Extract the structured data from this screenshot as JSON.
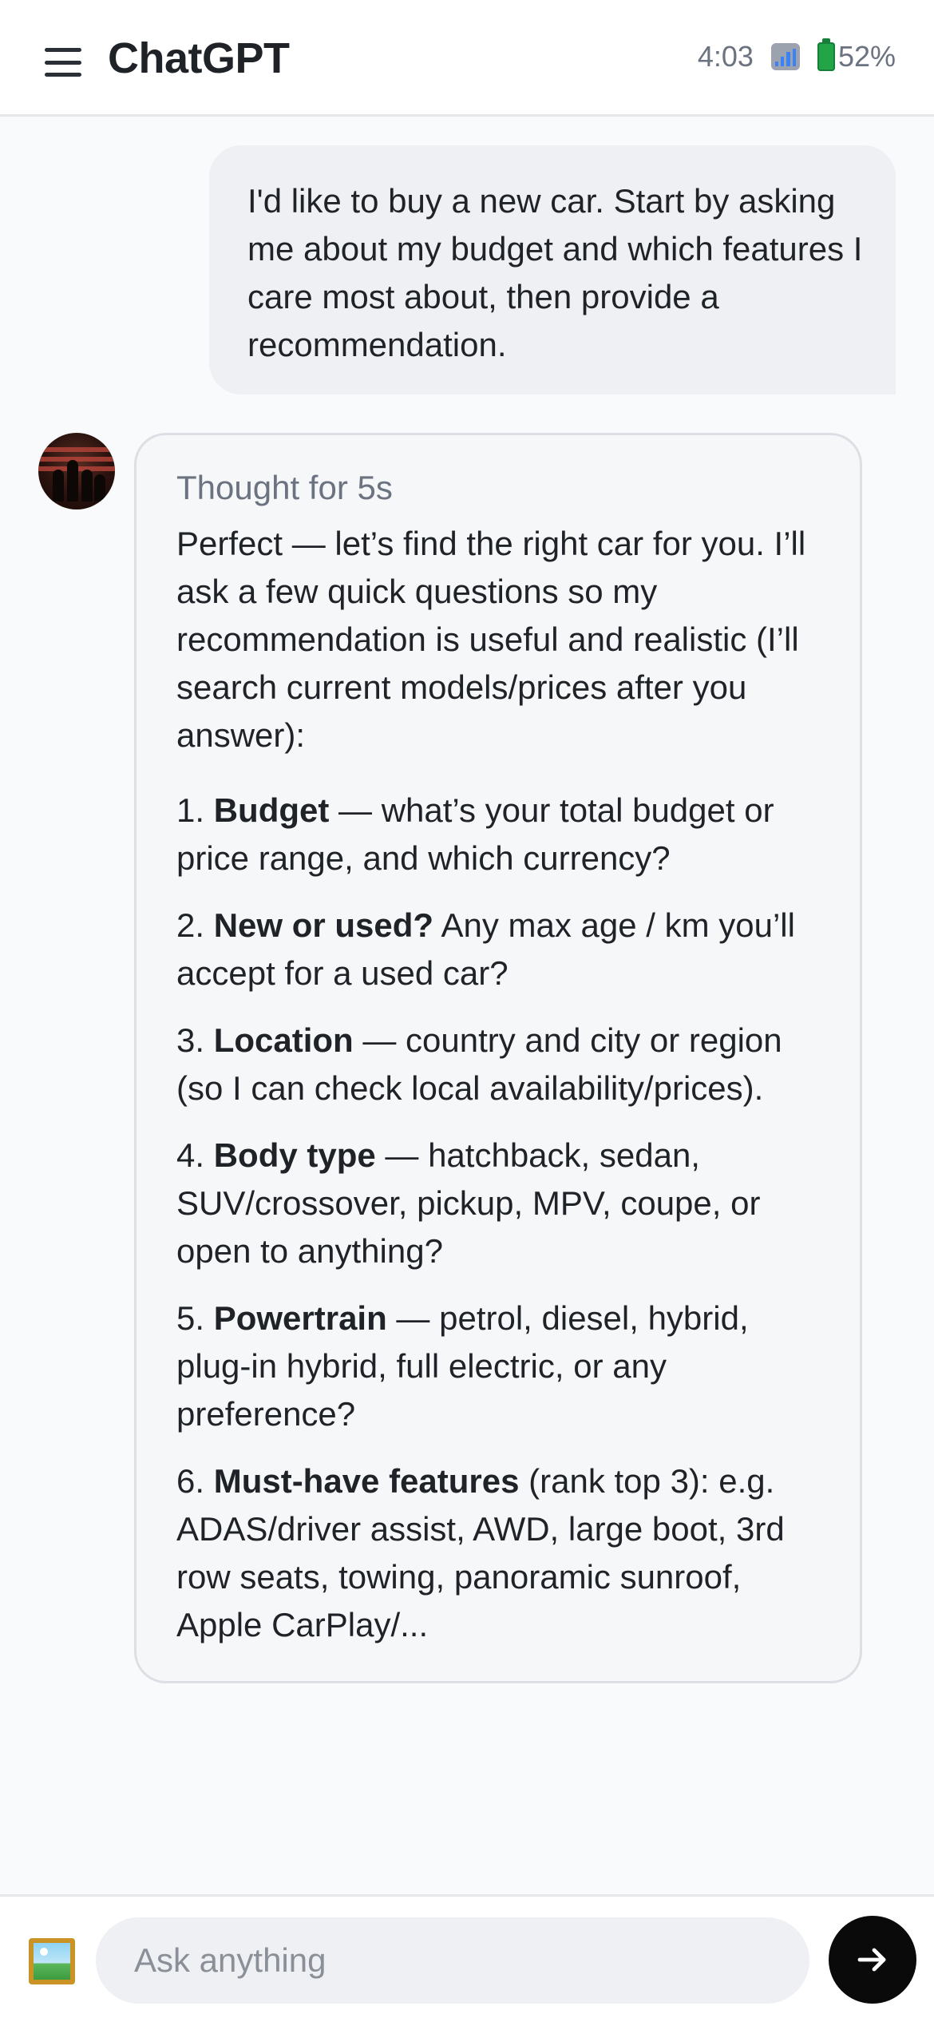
{
  "header": {
    "title": "ChatGPT",
    "time": "4:03",
    "battery": "52%"
  },
  "conversation": {
    "user_message": "I'd like to buy a new car. Start by asking me about my budget and which features I care most about, then provide a recommendation.",
    "assistant": {
      "thought": "Thought for 5s",
      "intro": "Perfect — let’s find the right car for you. I’ll ask a few quick questions so my recommendation is useful and realistic (I’ll search current models/prices after you answer):",
      "items": [
        {
          "num": "1.",
          "title": "Budget",
          "text": " — what’s your total budget or price range, and which currency?"
        },
        {
          "num": "2.",
          "title": "New or used?",
          "text": " Any max age / km you’ll accept for a used car?"
        },
        {
          "num": "3.",
          "title": "Location",
          "text": " — country and city or region (so I can check local availability/prices)."
        },
        {
          "num": "4.",
          "title": "Body type",
          "text": " — hatchback, sedan, SUV/crossover, pickup, MPV, coupe, or open to anything?"
        },
        {
          "num": "5.",
          "title": "Powertrain",
          "text": " — petrol, diesel, hybrid, plug-in hybrid, full electric, or any preference?"
        },
        {
          "num": "6.",
          "title": "Must-have features",
          "text": " (rank top 3): e.g. ADAS/driver assist, AWD, large boot, 3rd row seats, towing, panoramic sunroof, Apple CarPlay/..."
        }
      ]
    }
  },
  "composer": {
    "placeholder": "Ask anything"
  },
  "icons": {
    "menu": "hamburger-menu-icon",
    "signal": "signal-icon",
    "battery": "battery-icon",
    "image": "image-attach-icon",
    "send": "arrow-right-icon"
  },
  "colors": {
    "send_button": "#0a0a0a",
    "battery": "#22a447"
  }
}
